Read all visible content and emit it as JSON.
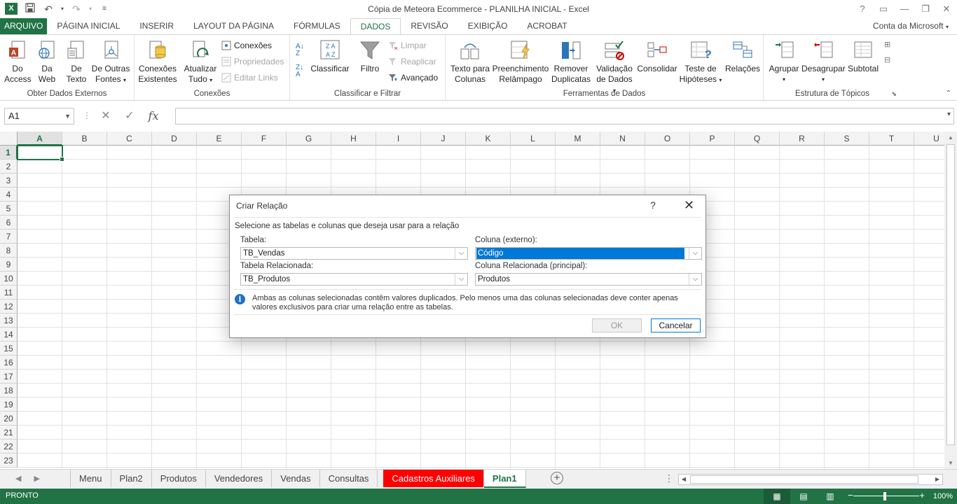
{
  "window": {
    "title": "Cópia de Meteora Ecommerce - PLANILHA INICIAL - Excel",
    "app_logo": "X",
    "qat_icons": [
      "save-icon",
      "undo-icon",
      "redo-icon",
      "customize-icon"
    ],
    "controls": [
      "?",
      "▭",
      "—",
      "❐",
      "✕"
    ]
  },
  "tabs": {
    "file": "ARQUIVO",
    "items": [
      "PÁGINA INICIAL",
      "INSERIR",
      "LAYOUT DA PÁGINA",
      "FÓRMULAS",
      "DADOS",
      "REVISÃO",
      "EXIBIÇÃO",
      "ACROBAT"
    ],
    "active": "DADOS",
    "account": "Conta da Microsoft"
  },
  "ribbon": {
    "external": {
      "label": "Obter Dados Externos",
      "access": [
        "Do",
        "Access"
      ],
      "web": [
        "Da",
        "Web"
      ],
      "text": [
        "De",
        "Texto"
      ],
      "other": [
        "De Outras",
        "Fontes"
      ]
    },
    "connections": {
      "label": "Conexões",
      "existing": [
        "Conexões",
        "Existentes"
      ],
      "refresh": [
        "Atualizar",
        "Tudo"
      ],
      "connections": "Conexões",
      "properties": "Propriedades",
      "edit_links": "Editar Links"
    },
    "sort": {
      "label": "Classificar e Filtrar",
      "sort": "Classificar",
      "filter": "Filtro",
      "clear": "Limpar",
      "reapply": "Reaplicar",
      "advanced": "Avançado"
    },
    "tools": {
      "label": "Ferramentas de Dados",
      "text_to_columns": [
        "Texto para",
        "Colunas"
      ],
      "flash_fill": [
        "Preenchimento",
        "Relâmpago"
      ],
      "remove_duplicates": [
        "Remover",
        "Duplicatas"
      ],
      "validation": [
        "Validação",
        "de Dados"
      ],
      "consolidate": "Consolidar",
      "what_if": [
        "Teste de",
        "Hipóteses"
      ],
      "relations": "Relações"
    },
    "outline": {
      "label": "Estrutura de Tópicos",
      "group": "Agrupar",
      "ungroup": "Desagrupar",
      "subtotal": "Subtotal"
    }
  },
  "formula": {
    "name_box": "A1",
    "value": ""
  },
  "grid": {
    "columns": [
      "A",
      "B",
      "C",
      "D",
      "E",
      "F",
      "G",
      "H",
      "I",
      "J",
      "K",
      "L",
      "M",
      "N",
      "O",
      "P",
      "Q",
      "R",
      "S",
      "T",
      "U"
    ],
    "rows": [
      "1",
      "2",
      "3",
      "4",
      "5",
      "6",
      "7",
      "8",
      "9",
      "10",
      "11",
      "12",
      "13",
      "14",
      "15",
      "16",
      "17",
      "18",
      "19",
      "20",
      "21",
      "22",
      "23"
    ],
    "active_cell": "A1"
  },
  "sheets": {
    "tabs": [
      "Menu",
      "Plan2",
      "Produtos",
      "Vendedores",
      "Vendas",
      "Consultas",
      "Cadastros Auxiliares",
      "Plan1"
    ],
    "active": "Plan1",
    "highlighted": "Cadastros Auxiliares",
    "highlight_color": "#ff0000"
  },
  "status": {
    "ready": "PRONTO",
    "zoom": "100%"
  },
  "dialog": {
    "title": "Criar Relação",
    "help": "?",
    "close": "✕",
    "instruction": "Selecione as tabelas e colunas que deseja usar para a relação",
    "table_label": "Tabela:",
    "table_value": "TB_Vendas",
    "column_label": "Coluna (externo):",
    "column_value": "Código",
    "related_table_label": "Tabela Relacionada:",
    "related_table_value": "TB_Produtos",
    "related_column_label": "Coluna Relacionada (principal):",
    "related_column_value": "Produtos",
    "info_line1": "Ambas as colunas selecionadas contêm valores duplicados. Pelo menos uma das colunas selecionadas deve conter apenas",
    "info_line2": "valores exclusivos para criar uma relação entre as tabelas.",
    "ok": "OK",
    "cancel": "Cancelar"
  },
  "colors": {
    "excel_green": "#217346",
    "selection_blue": "#0078d7"
  }
}
